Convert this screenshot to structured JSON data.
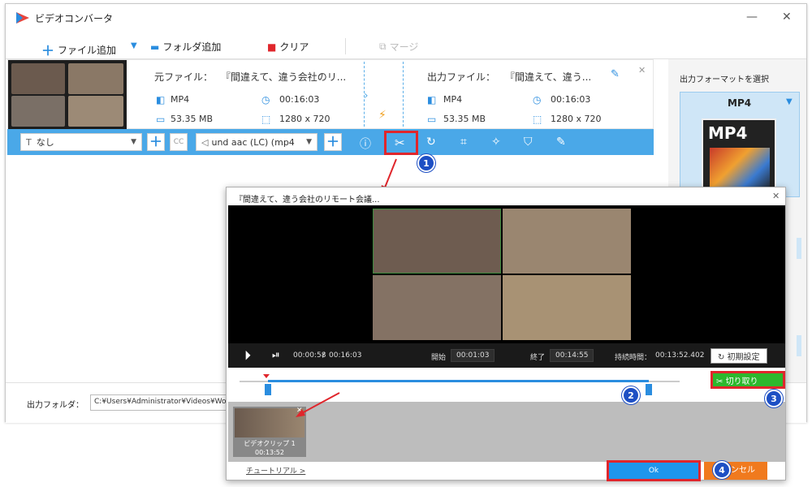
{
  "window": {
    "title": "ビデオコンバータ"
  },
  "toolbar": {
    "add_file": "ファイル追加",
    "add_folder": "フォルダ追加",
    "clear": "クリア",
    "merge": "マージ"
  },
  "file": {
    "source_label": "元ファイル：",
    "source_name": "『間違えて、違う会社のリ...",
    "output_label": "出力ファイル：",
    "output_name": "『間違えて、違う...",
    "src_format": "MP4",
    "src_duration": "00:16:03",
    "src_size": "53.35 MB",
    "src_resolution": "1280 x 720",
    "out_format": "MP4",
    "out_duration": "00:16:03",
    "out_size": "53.35 MB",
    "out_resolution": "1280 x 720"
  },
  "options": {
    "subtitle": "なし",
    "audio": "und aac (LC) (mp4",
    "subtitle_icon_text": "T",
    "cc_text": "CC"
  },
  "right_panel": {
    "heading": "出力フォーマットを選択",
    "format": "MP4",
    "format_logo": "MP4"
  },
  "output_folder": {
    "label": "出力フォルダ：",
    "path": "C:¥Users¥Administrator¥Videos¥Wonde"
  },
  "dialog": {
    "title": "『間違えて、違う会社のリモート会議...",
    "current_time": "00:00:58",
    "total_time": "00:16:03",
    "time_sep": "/",
    "start_label": "開始",
    "start_value": "00:01:03",
    "end_label": "終了",
    "end_value": "00:14:55",
    "duration_label": "持続時間：",
    "duration_value": "00:13:52.402",
    "reset_label": "初期設定",
    "cut_label": "切り取り",
    "clip_name": "ビデオクリップ 1",
    "clip_duration": "00:13:52",
    "tutorial_link": "チュートリアル >",
    "ok_label": "Ok",
    "cancel_label": "ンセル",
    "trim_start_fraction": 0.065,
    "trim_end_fraction": 0.93,
    "playhead_fraction": 0.06
  },
  "badges": [
    "1",
    "2",
    "3",
    "4"
  ],
  "colors": {
    "accent": "#2a8ddf",
    "option_bar": "#4aa8e8",
    "highlight": "#e0262c",
    "badge": "#1d4fc4",
    "cut_button": "#2db82d",
    "ok_button": "#1e96ec",
    "cancel_button": "#f07a1e"
  }
}
